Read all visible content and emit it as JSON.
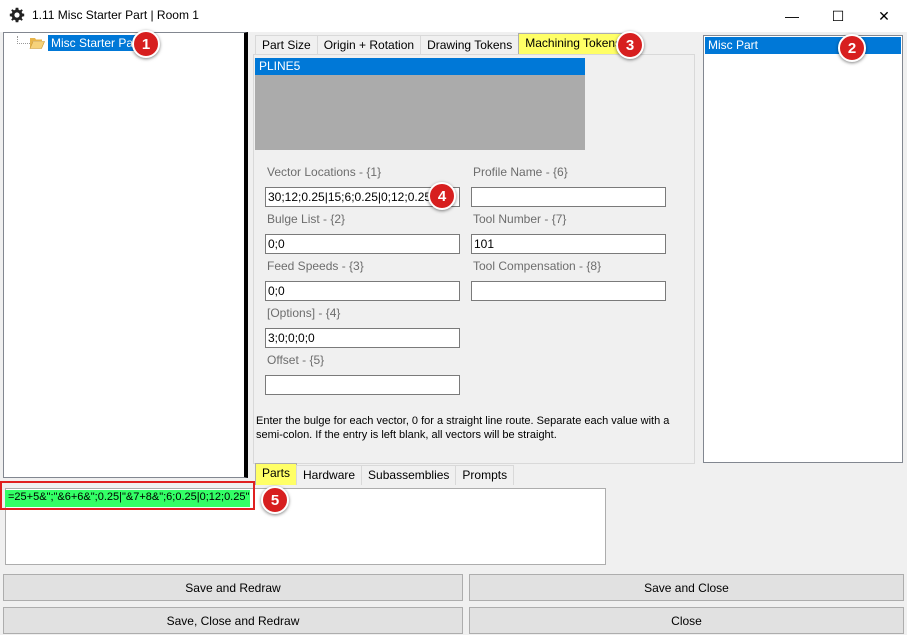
{
  "window": {
    "title": "1.11 Misc Starter Part | Room 1",
    "minimize_glyph": "—",
    "maximize_glyph": "☐",
    "close_glyph": "✕"
  },
  "tree": {
    "root_label": "Misc Starter Part"
  },
  "top_tabs": [
    {
      "label": "Part  Size",
      "active": false
    },
    {
      "label": "Origin + Rotation",
      "active": false
    },
    {
      "label": "Drawing Tokens",
      "active": false
    },
    {
      "label": "Machining Tokens",
      "active": true
    }
  ],
  "pline_list": {
    "items": [
      "PLINE5"
    ]
  },
  "fields": {
    "vector_locations": {
      "label": "Vector Locations - {1}",
      "value": "30;12;0.25|15;6;0.25|0;12;0.25"
    },
    "bulge_list": {
      "label": "Bulge List - {2}",
      "value": "0;0"
    },
    "feed_speeds": {
      "label": "Feed Speeds - {3}",
      "value": "0;0"
    },
    "options": {
      "label": "[Options] - {4}",
      "value": "3;0;0;0;0"
    },
    "offset": {
      "label": "Offset - {5}",
      "value": ""
    },
    "profile_name": {
      "label": "Profile Name - {6}",
      "value": ""
    },
    "tool_number": {
      "label": "Tool Number - {7}",
      "value": "101"
    },
    "tool_compensation": {
      "label": "Tool Compensation - {8}",
      "value": ""
    }
  },
  "help_text": "Enter the bulge for each vector, 0 for a straight line route. Separate each value with a semi-colon. If the entry is left blank, all vectors will be straight.",
  "right_panel": {
    "items": [
      "Misc Part"
    ]
  },
  "bottom_tabs": [
    {
      "label": "Parts",
      "active": true
    },
    {
      "label": "Hardware",
      "active": false
    },
    {
      "label": "Subassemblies",
      "active": false
    },
    {
      "label": "Prompts",
      "active": false
    }
  ],
  "formula": {
    "value": "=25+5&\";\"&6+6&\";0.25|\"&7+8&\";6;0.25|0;12;0.25\""
  },
  "buttons": {
    "save_redraw": "Save and Redraw",
    "save_close": "Save and Close",
    "save_close_redraw": "Save, Close and Redraw",
    "close": "Close"
  },
  "callouts": [
    "1",
    "2",
    "3",
    "4",
    "5"
  ],
  "colors": {
    "selection": "#0078d7",
    "active_tab": "#ffff66",
    "formula_highlight": "#33ff66",
    "callout": "#d71f1f"
  }
}
